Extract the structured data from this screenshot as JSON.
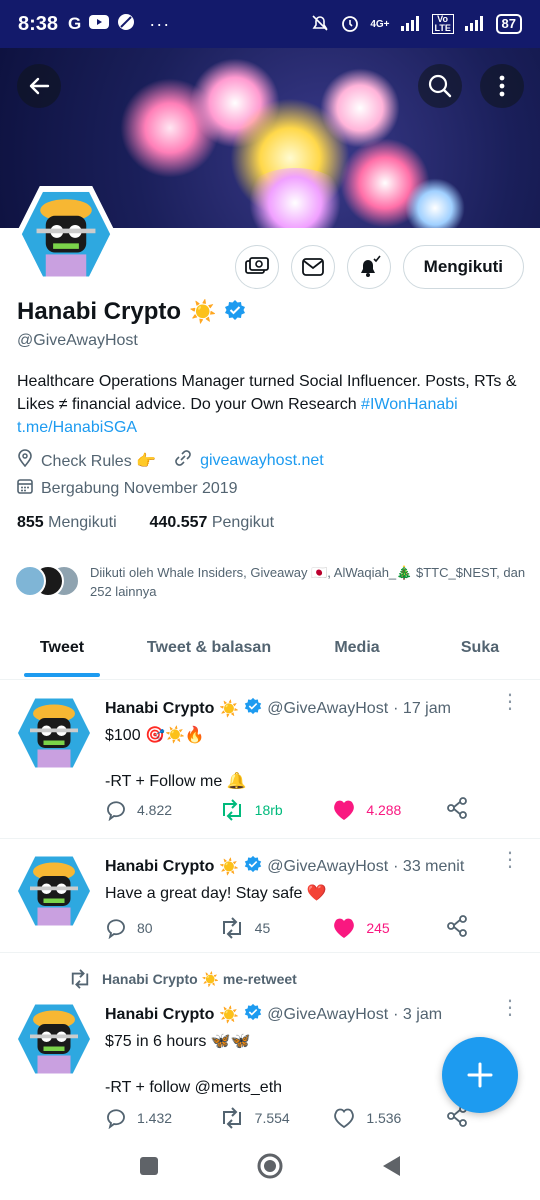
{
  "status_bar": {
    "time": "8:38",
    "network": "4G+",
    "volte": "Vo LTE",
    "battery": "87"
  },
  "profile": {
    "name": "Hanabi Crypto",
    "name_emoji": "☀️",
    "handle": "@GiveAwayHost",
    "bio_text": "Healthcare Operations Manager turned Social Influencer. Posts, RTs & Likes ≠ financial advice. Do your Own Research ",
    "bio_hashtag": "#IWonHanabi",
    "bio_link": "t.me/HanabiSGA",
    "check_rules": "Check Rules 👉",
    "website": "giveawayhost.net",
    "joined": "Bergabung November 2019",
    "following_count": "855",
    "following_label": "Mengikuti",
    "followers_count": "440.557",
    "followers_label": "Pengikut",
    "followed_by": "Diikuti oleh Whale Insiders, Giveaway 🇯🇵, AlWaqiah_🎄 $TTC_$NEST, dan 252 lainnya",
    "follow_button": "Mengikuti"
  },
  "tabs": [
    "Tweet",
    "Tweet & balasan",
    "Media",
    "Suka"
  ],
  "tweets": [
    {
      "name": "Hanabi Crypto",
      "emoji": "☀️",
      "handle": "@GiveAwayHost",
      "time": "· 17 jam",
      "text": "$100 🎯☀️🔥\n\n-RT + Follow me 🔔",
      "replies": "4.822",
      "retweets": "18rb",
      "likes": "4.288"
    },
    {
      "name": "Hanabi Crypto",
      "emoji": "☀️",
      "handle": "@GiveAwayHost",
      "time": "· 33 menit",
      "text": "Have a great day! Stay safe ❤️",
      "replies": "80",
      "retweets": "45",
      "likes": "245"
    },
    {
      "retweeted_by": "Hanabi Crypto ☀️ me-retweet",
      "name": "Hanabi Crypto",
      "emoji": "☀️",
      "handle": "@GiveAwayHost",
      "time": "· 3 jam",
      "text": "$75 in 6 hours 🦋🦋\n\n-RT + follow @merts_eth",
      "replies": "1.432",
      "retweets": "7.554",
      "likes": "1.536"
    }
  ],
  "colors": {
    "accent": "#1d9bf0",
    "retweet_green": "#00ba7c",
    "like_pink": "#f91880",
    "status_bar": "#131a6b"
  }
}
